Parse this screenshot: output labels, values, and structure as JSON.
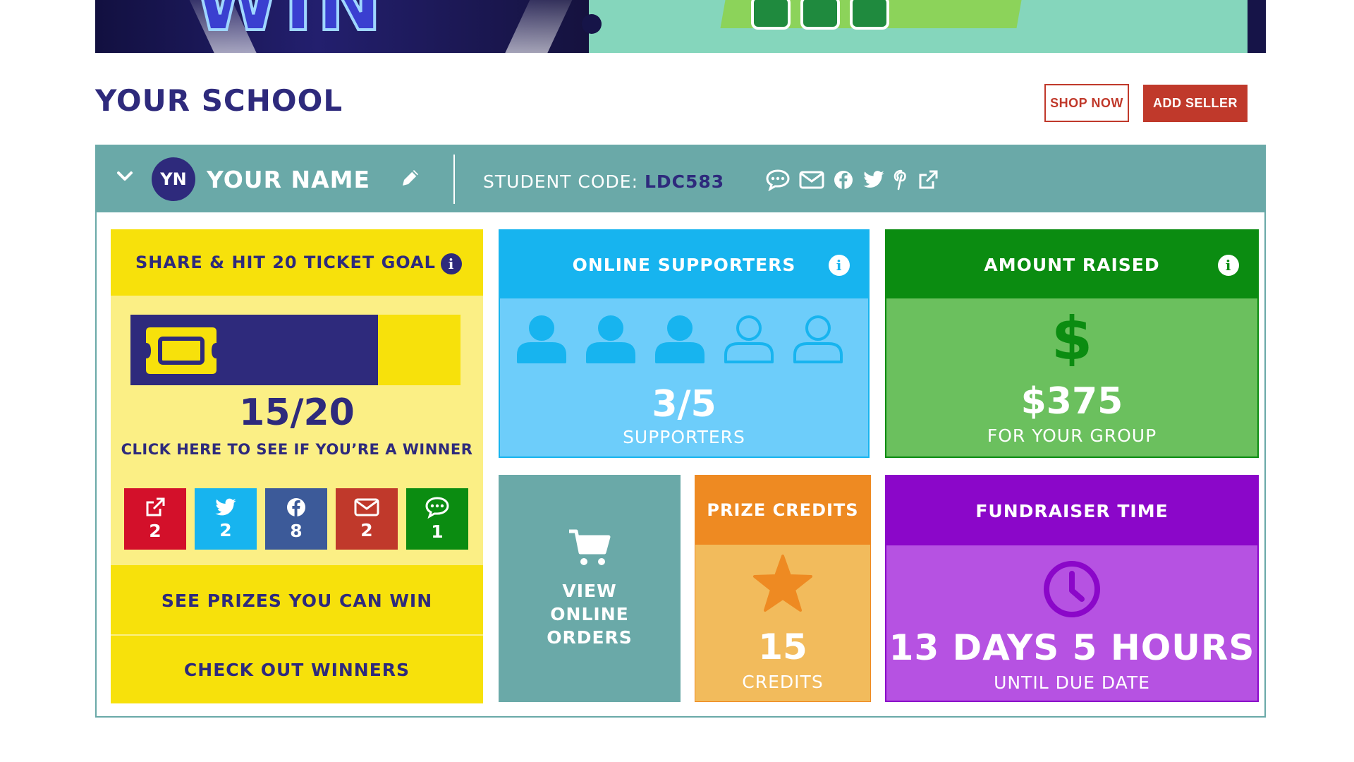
{
  "banner": {
    "headline": "WIN"
  },
  "header": {
    "title": "YOUR SCHOOL",
    "shop_label": "SHOP NOW",
    "add_seller_label": "ADD SELLER"
  },
  "student": {
    "initials": "YN",
    "name": "YOUR NAME",
    "code_label": "STUDENT CODE:",
    "code_value": "LDC583"
  },
  "ticket_goal": {
    "title": "SHARE & HIT 20 TICKET GOAL",
    "progress_text": "15/20",
    "progress_fraction": 0.75,
    "winner_link": "CLICK HERE TO SEE IF YOU’RE A WINNER",
    "shares": [
      {
        "icon": "external-link-icon",
        "count": "2",
        "color": "#d3102a"
      },
      {
        "icon": "twitter-icon",
        "count": "2",
        "color": "#17b4ef"
      },
      {
        "icon": "facebook-icon",
        "count": "8",
        "color": "#3c5a99"
      },
      {
        "icon": "email-icon",
        "count": "2",
        "color": "#c0392b"
      },
      {
        "icon": "chat-icon",
        "count": "1",
        "color": "#0b8c11"
      }
    ],
    "prizes_link": "SEE PRIZES YOU CAN WIN",
    "winners_link": "CHECK OUT WINNERS"
  },
  "online_supporters": {
    "title": "ONLINE SUPPORTERS",
    "value": "3/5",
    "filled": 3,
    "total": 5,
    "label": "SUPPORTERS"
  },
  "amount_raised": {
    "title": "AMOUNT RAISED",
    "value": "$375",
    "label": "FOR YOUR GROUP"
  },
  "orders": {
    "label": "VIEW\nONLINE\nORDERS"
  },
  "prize_credits": {
    "title": "PRIZE CREDITS",
    "value": "15",
    "label": "CREDITS"
  },
  "fundraiser_time": {
    "title": "FUNDRAISER TIME",
    "value": "13 DAYS 5 HOURS",
    "label": "UNTIL DUE DATE"
  },
  "colors": {
    "navy": "#2e2a7c",
    "teal": "#6aa9a8",
    "yellow": "#f7e10b",
    "blue": "#17b4ef",
    "green": "#0b8c11",
    "orange": "#ee8a22",
    "purple": "#8b07c9",
    "red": "#c0392b"
  }
}
